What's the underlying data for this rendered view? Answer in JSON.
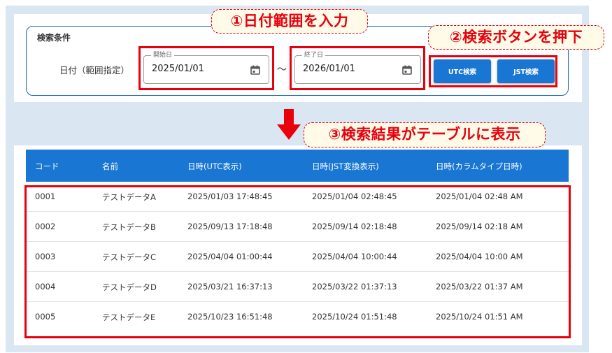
{
  "search": {
    "title": "検索条件",
    "date_label": "日付（範囲指定）",
    "start": {
      "legend": "開始日",
      "value": "2025/01/01"
    },
    "end": {
      "legend": "終了日",
      "value": "2026/01/01"
    },
    "tilde": "～",
    "utc_button": "UTC検索",
    "jst_button": "JST検索"
  },
  "callouts": {
    "step1": "①日付範囲を入力",
    "step2": "②検索ボタンを押下",
    "step3": "③検索結果がテーブルに表示"
  },
  "colors": {
    "accent": "#1976d2",
    "highlight": "#e8000c",
    "callout_bg": "#fffbe8",
    "panel_bg": "#dbe6f3"
  },
  "table": {
    "headers": [
      "コード",
      "名前",
      "日時(UTC表示)",
      "日時(JST変換表示)",
      "日時(カラムタイプ日時)"
    ],
    "rows": [
      [
        "0001",
        "テストデータA",
        "2025/01/03 17:48:45",
        "2025/01/04 02:48:45",
        "2025/01/04 02:48 AM"
      ],
      [
        "0002",
        "テストデータB",
        "2025/09/13 17:18:48",
        "2025/09/14 02:18:48",
        "2025/09/14 02:18 AM"
      ],
      [
        "0003",
        "テストデータC",
        "2025/04/04 01:00:44",
        "2025/04/04 10:00:44",
        "2025/04/04 10:00 AM"
      ],
      [
        "0004",
        "テストデータD",
        "2025/03/21 16:37:13",
        "2025/03/22 01:37:13",
        "2025/03/22 01:37 AM"
      ],
      [
        "0005",
        "テストデータE",
        "2025/10/23 16:51:48",
        "2025/10/24 01:51:48",
        "2025/10/24 01:51 AM"
      ]
    ]
  }
}
